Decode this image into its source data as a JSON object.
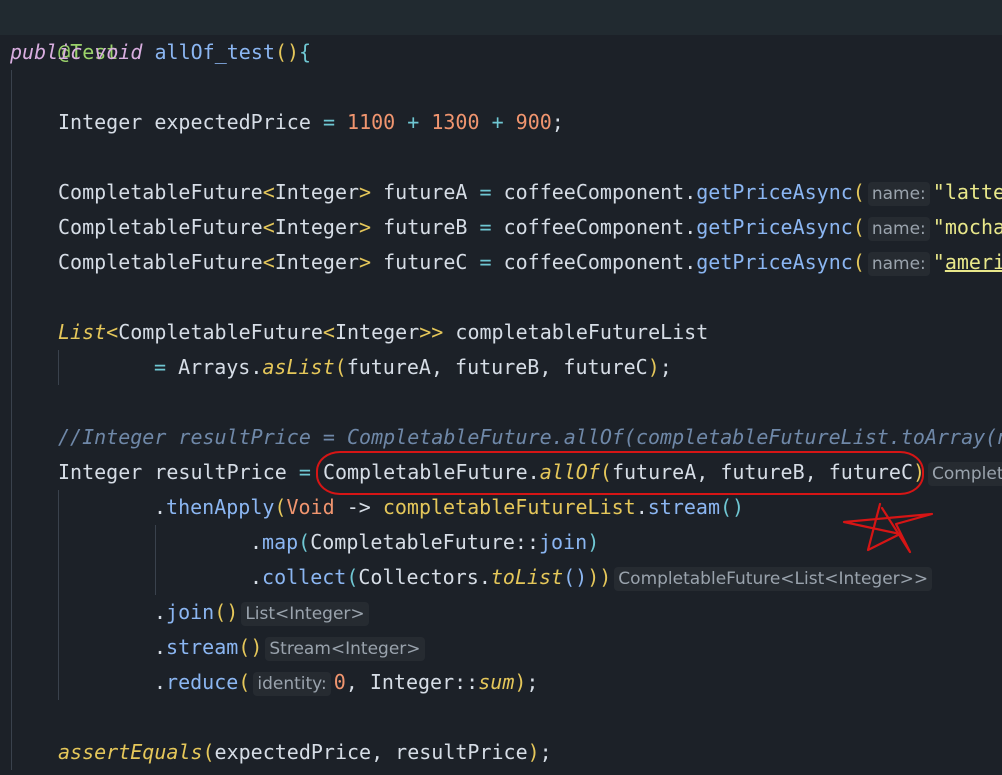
{
  "code": {
    "annotation": "@Test",
    "sig": {
      "kw1": "public",
      "kw2": "void",
      "name": "allOf_test",
      "open": "(){",
      "p1": "()",
      "b1": "{"
    },
    "l3": {
      "type": "Integer",
      "var": "expectedPrice",
      "eq": "=",
      "n1": "1100",
      "plus1": "+",
      "n2": "1300",
      "plus2": "+",
      "n3": "900",
      "semi": ";"
    },
    "futures": [
      {
        "type": "CompletableFuture",
        "lt": "<",
        "gen": "Integer",
        "gt": ">",
        "var": "futureA",
        "eq": "=",
        "obj": "coffeeComponent",
        "dot": ".",
        "meth": "getPriceAsync",
        "paren": "(",
        "hint": "name:",
        "arg": "\"latte"
      },
      {
        "type": "CompletableFuture",
        "lt": "<",
        "gen": "Integer",
        "gt": ">",
        "var": "futureB",
        "eq": "=",
        "obj": "coffeeComponent",
        "dot": ".",
        "meth": "getPriceAsync",
        "paren": "(",
        "hint": "name:",
        "arg": "\"mocha"
      },
      {
        "type": "CompletableFuture",
        "lt": "<",
        "gen": "Integer",
        "gt": ">",
        "var": "futureC",
        "eq": "=",
        "obj": "coffeeComponent",
        "dot": ".",
        "meth": "getPriceAsync",
        "paren": "(",
        "hint": "name:",
        "arg1": "\"",
        "arg2": "americ"
      }
    ],
    "listDecl": {
      "type": "List",
      "lt": "<",
      "inner": "CompletableFuture",
      "lt2": "<",
      "gen": "Integer",
      "gt2": ">>",
      "var": "completableFutureList"
    },
    "listInit": {
      "eq": "=",
      "cls": "Arrays",
      "dot": ".",
      "meth": "asList",
      "open": "(",
      "args": "futureA, futureB, futureC",
      "close": ")",
      "semi": ";"
    },
    "comment": "//Integer resultPrice = CompletableFuture.allOf(completableFutureList.toArray(n",
    "result": {
      "type": "Integer",
      "var": "resultPrice",
      "eq": "=",
      "cls": "CompletableFuture",
      "dot": ".",
      "meth": "allOf",
      "open": "(",
      "args": "futureA, futureB, futureC",
      "close": ")",
      "hint": "Complet"
    },
    "thenApply": {
      "dot": ".",
      "meth": "thenApply",
      "open": "(",
      "arg": "Void",
      "arrow": "->",
      "obj": "completableFutureList",
      "dot2": ".",
      "meth2": "stream",
      "parens": "()"
    },
    "map": {
      "dot": ".",
      "meth": "map",
      "open": "(",
      "cls": "CompletableFuture",
      "dc": "::",
      "ref": "join",
      "close": ")"
    },
    "collect": {
      "dot": ".",
      "meth": "collect",
      "open": "(",
      "cls": "Collectors",
      "dot2": ".",
      "meth2": "toList",
      "parens": "()",
      "close": "))",
      "hint": "CompletableFuture<List<Integer>>"
    },
    "join": {
      "dot": ".",
      "meth": "join",
      "parens": "()",
      "hint": "List<Integer>"
    },
    "stream": {
      "dot": ".",
      "meth": "stream",
      "parens": "()",
      "hint": "Stream<Integer>"
    },
    "reduce": {
      "dot": ".",
      "meth": "reduce",
      "open": "(",
      "hint": "identity:",
      "zero": "0",
      "comma": ",",
      "cls": "Integer",
      "dc": "::",
      "ref": "sum",
      "close": ")",
      "semi": ";"
    },
    "assert": {
      "meth": "assertEquals",
      "open": "(",
      "args": "expectedPrice, resultPrice",
      "close": ")",
      "semi": ";"
    }
  },
  "colors": {
    "background": "#1c2128",
    "annotation": "#9ad26a",
    "keyword": "#d9aee0",
    "method": "#8bb6f2",
    "number": "#f0956f",
    "string": "#e8e78a",
    "comment": "#6f88a8",
    "markup": "#d61515"
  }
}
